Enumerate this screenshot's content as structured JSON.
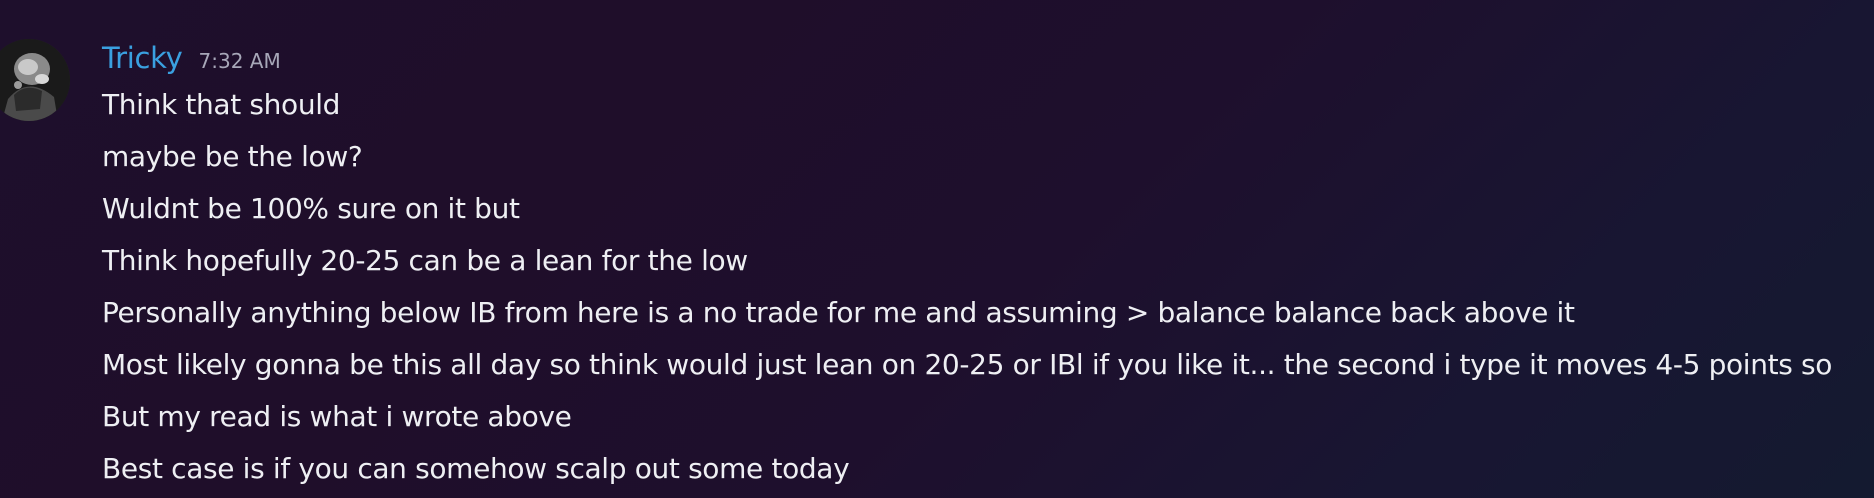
{
  "message": {
    "author": "Tricky",
    "timestamp": "7:32 AM",
    "author_color": "#3aa0e0",
    "avatar_icon": "user-avatar-photo",
    "lines": [
      "Think that should",
      "maybe be the low?",
      "Wuldnt be 100% sure on it but",
      "Think hopefully 20-25 can be a lean for the low",
      "Personally anything below IB from here is a no trade for me and assuming > balance balance back above it",
      "Most likely gonna be this all day so think would just lean on 20-25 or IBl if you like it... the second i type it moves 4-5 points so",
      "But my read is what i wrote above",
      "Best case is if you can somehow scalp out some today"
    ]
  }
}
